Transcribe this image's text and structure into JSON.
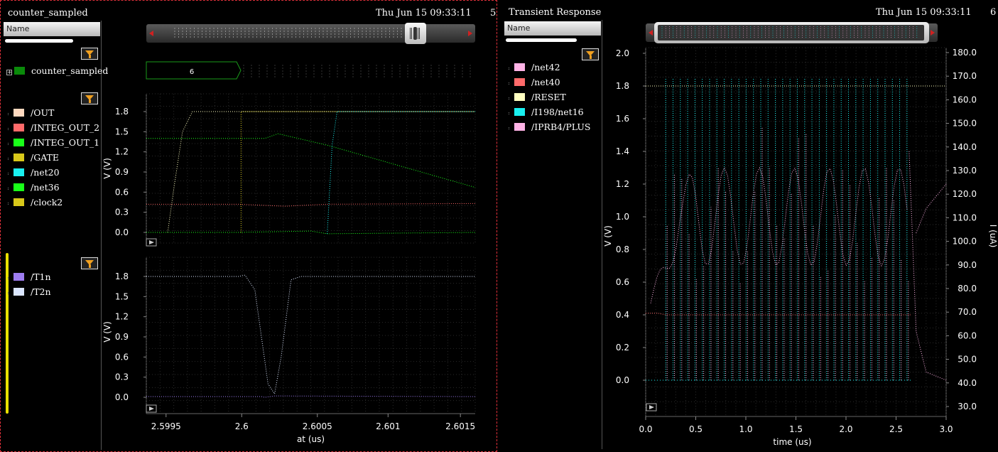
{
  "left": {
    "title": "counter_sampled",
    "timestamp": "Thu Jun 15 09:33:11",
    "page_number": "5",
    "name_header": "Name",
    "group": {
      "label": "counter_sampled",
      "color": "#0a8a0a"
    },
    "bus_value": "6",
    "strip1_signals": [
      {
        "label": "/OUT",
        "color": "#ffd9bf"
      },
      {
        "label": "/INTEG_OUT_2",
        "color": "#ff6a6a"
      },
      {
        "label": "/INTEG_OUT_1",
        "color": "#19ff19"
      },
      {
        "label": "/GATE",
        "color": "#d8c81a"
      },
      {
        "label": "/net20",
        "color": "#19f0f0"
      },
      {
        "label": "/net36",
        "color": "#19ff19"
      },
      {
        "label": "/clock2",
        "color": "#d8c81a"
      }
    ],
    "strip2_signals": [
      {
        "label": "/T1n",
        "color": "#9d7cf0"
      },
      {
        "label": "/T2n",
        "color": "#dbe6ff"
      }
    ],
    "y_label": "V (V)",
    "x_label": "at (us)",
    "y_ticks": [
      "1.8",
      "1.5",
      "1.2",
      "0.9",
      "0.6",
      "0.3",
      "0.0"
    ],
    "x_ticks": [
      "2.5995",
      "2.6",
      "2.6005",
      "2.601",
      "2.6015"
    ]
  },
  "right": {
    "title": "Transient Response",
    "timestamp": "Thu Jun 15 09:33:11",
    "page_number": "6",
    "name_header": "Name",
    "signals": [
      {
        "label": "/net42",
        "color": "#ffb3e6"
      },
      {
        "label": "/net40",
        "color": "#ff6a6a"
      },
      {
        "label": "/RESET",
        "color": "#ffffc0"
      },
      {
        "label": "/I198/net16",
        "color": "#19f0f0"
      },
      {
        "label": "/IPRB4/PLUS",
        "color": "#ffb3e6"
      }
    ],
    "y_label": "V (V)",
    "y2_label": "I (uA)",
    "x_label": "time (us)",
    "y_ticks": [
      "2.0",
      "1.8",
      "1.6",
      "1.4",
      "1.2",
      "1.0",
      "0.8",
      "0.6",
      "0.4",
      "0.2",
      "0.0"
    ],
    "y2_ticks": [
      "180.0",
      "170.0",
      "160.0",
      "150.0",
      "140.0",
      "130.0",
      "120.0",
      "110.0",
      "100.0",
      "90.0",
      "80.0",
      "70.0",
      "60.0",
      "50.0",
      "40.0",
      "30.0"
    ],
    "x_ticks": [
      "0.0",
      "0.5",
      "1.0",
      "1.5",
      "2.0",
      "2.5",
      "3.0"
    ]
  }
}
